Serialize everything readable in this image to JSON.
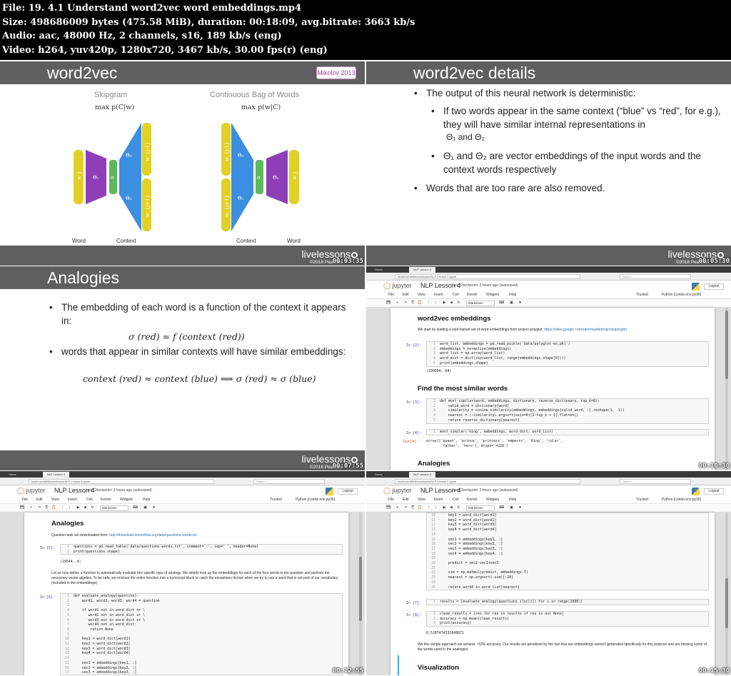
{
  "header": {
    "file": "File: 19. 4.1 Understand word2vec word embeddings.mp4",
    "size": "Size: 498686009 bytes (475.58 MiB), duration: 00:18:09, avg.bitrate: 3663 kb/s",
    "audio": "Audio: aac, 48000 Hz, 2 channels, s16, 189 kb/s (eng)",
    "video": "Video: h264, yuv420p, 1280x720, 3467 kb/s, 30.00 fps(r) (eng)"
  },
  "common": {
    "brand": "livelessons",
    "copyright": "©2018 Pearson"
  },
  "tiles": [
    {
      "title": "word2vec",
      "badge": "Mikolov 2013",
      "timestamp": "00:03:35",
      "skipgram": "Skipgram",
      "skipgram_formula": "max p(C|w)",
      "cbow": "Continuous Bag of Words",
      "cbow_formula": "max p(w|C)",
      "labels": {
        "word_left": "Word",
        "context_left": "Context",
        "context_right": "Context",
        "word_right": "Word",
        "wj": "w_j",
        "wjm1": "w_{j-1}",
        "wjp1": "w_{j+1}",
        "sigma": "σ",
        "theta1": "Θ₁",
        "theta2": "Θ₂"
      }
    },
    {
      "title": "word2vec details",
      "timestamp": "00:05:30",
      "b1": "The output of this neural network is deterministic:",
      "b2": "If two words appear in the same context (“blue” vs “red”, for e.g.), they will have similar internal representations in",
      "b2b": "Θ₁ and Θ₂",
      "b3": "Θ₁ and Θ₂ are vector embeddings of the input words and the context words respectively",
      "b4": "Words that are too rare are also removed."
    },
    {
      "title": "Analogies",
      "timestamp": "00:07:55",
      "b1": "The embedding of each word is a function of the context it appears in:",
      "f1": "σ (red) = f (context (red))",
      "b2": "words that appear in similar contexts will have similar embeddings:",
      "f2": "context (red) ≈ context (blue)  ⟹  σ (red) ≈ σ (blue)"
    },
    {
      "timestamp": "00:10:30"
    },
    {
      "timestamp": "00:12:55"
    },
    {
      "timestamp": "00:15:30"
    }
  ],
  "jupyter": {
    "tab_home": "Home",
    "tab_nb": "NLP Lesson 4",
    "url": "localhost:8888/notebooks/NLP Lesson 4.ipynb",
    "zoom": "110%",
    "search": "Search",
    "logo": "jupyter",
    "notebook": "NLP Lesson 4",
    "checkpoint": "Last Checkpoint: 3 hours ago (autosaved)",
    "logout": "Logout",
    "menu": [
      "File",
      "Edit",
      "View",
      "Insert",
      "Cell",
      "Kernel",
      "Widgets",
      "Help"
    ],
    "trusted": "Trusted",
    "kernel": "Python [conda env:py36]",
    "celltype": "Markdown",
    "toolbar": [
      "💾",
      "+",
      "✂",
      "⎘",
      "📋",
      "↑",
      "↓",
      "▶",
      "■",
      "↻",
      "⌨",
      "▣",
      "⏺"
    ]
  },
  "nb4": {
    "h1": "word2vec embeddings",
    "p1": "We start by loading a well trained set of word embeddings from project polyglot:",
    "p1link": "https://sites.google.com/site/rmyeid/projects/polyglot",
    "in2": "In [2]:",
    "c2": [
      "word_list, embeddings = pd.read_pickle('data/polyglot-en.pkl')",
      "embeddings = normalize(embeddings)",
      "word_list = np.array(word_list)",
      "word_dict = dict(zip(word_list, range(embeddings.shape[0])))",
      "print(embeddings.shape)"
    ],
    "o2": "(100004, 64)",
    "h2": "Find the most similar words",
    "in3": "In [3]:",
    "c3": [
      "def most_similar(word, embeddings, dictionary, reverse_dictionary, top_k=8):",
      "    valid_word = dictionary[word]",
      "    similarity = cosine_similarity(embeddings, embeddings[valid_word, :].reshape(1, -1))",
      "    nearest = (-similarity).argsort(axis=0)[1:top_k + 1].flatten()",
      "    return reverse_dictionary[nearest]"
    ],
    "in4": "In [4]:",
    "c4": [
      "most_similar('king', embeddings, word_dict, word_list)"
    ],
    "out4": "Out[4]:",
    "o4": "array(['queen', 'prince', 'princess', 'emperor', 'King', 'ruler',\n       'father', 'hero'], dtype='<U28')",
    "h3": "Analogies"
  },
  "nb5": {
    "h1": "Analogies",
    "p1": "Question task set downloaded from:",
    "p1link": "http://download.tensorflow.org/data/questions-words.txt",
    "in5": "In [5]:",
    "c5": [
      "questions = pd.read_table('data/questions-words.txt', comment=':', sep=' ', header=None)",
      "print(questions.shape)"
    ],
    "o5": "(19544, 4)",
    "p2": "Let us now define a function to automatically evaluate this specific type of analogy. We simply look up the embeddings for each of the four words in the question and perform the necessary vector algebra. To be safe, we enclose the entire function into a try/except block to catch the exceptions thrown when we try to use a word that is not part of our vocabulary (included in the embeddings)",
    "in6": "In [6]:",
    "c6": [
      "def evaluate_analogy(question):",
      "    word1, word2, word3, word4 = question",
      "",
      "    if word1 not in word_dict or \\",
      "       word2 not in word_dict or \\",
      "       word3 not in word_dict or \\",
      "       word4 not in word_dict:",
      "        return None",
      "",
      "    key1 = word_dict[word1]",
      "    key2 = word_dict[word2]",
      "    key3 = word_dict[word3]",
      "    key4 = word_dict[word4]",
      "",
      "    vec1 = embeddings[key1, :]",
      "    vec2 = embeddings[key2, :]",
      "    vec3 = embeddings[key3, :]"
    ]
  },
  "nb6": {
    "c6start": 10,
    "c6": [
      "    key1 = word_dict[word1]",
      "    key2 = word_dict[word2]",
      "    key3 = word_dict[word3]",
      "    key4 = word_dict[word4]",
      "",
      "    vec1 = embeddings[key1, :]",
      "    vec2 = embeddings[key2, :]",
      "    vec3 = embeddings[key3, :]",
      "    vec4 = embeddings[key4, :]",
      "",
      "    predict = vec2-vec1+vec3",
      "",
      "    sim = np.matmul(predict, embeddings.T)",
      "    nearest = np.argsort(-sim)[:10]",
      "",
      "    return word4 in word_list[nearest]"
    ],
    "in7": "In [7]:",
    "c7": [
      "results = [evaluate_analogy(questions.iloc[i]) for i in range(1000)]"
    ],
    "in8": "In [8]:",
    "c8": [
      "clean_results = [res for res in results if res is not None]",
      "accuracy = np.mean(clean_results)",
      "print(accuracy)"
    ],
    "o8": "0.5287474332648871",
    "p1": "We this simple approach we achieve ~53% accuracy. Our results are penalized by the fact that our embeddings weren't generated specifically for this purpose and are missing some of the words used in the analogies.",
    "h1": "Visualization"
  }
}
